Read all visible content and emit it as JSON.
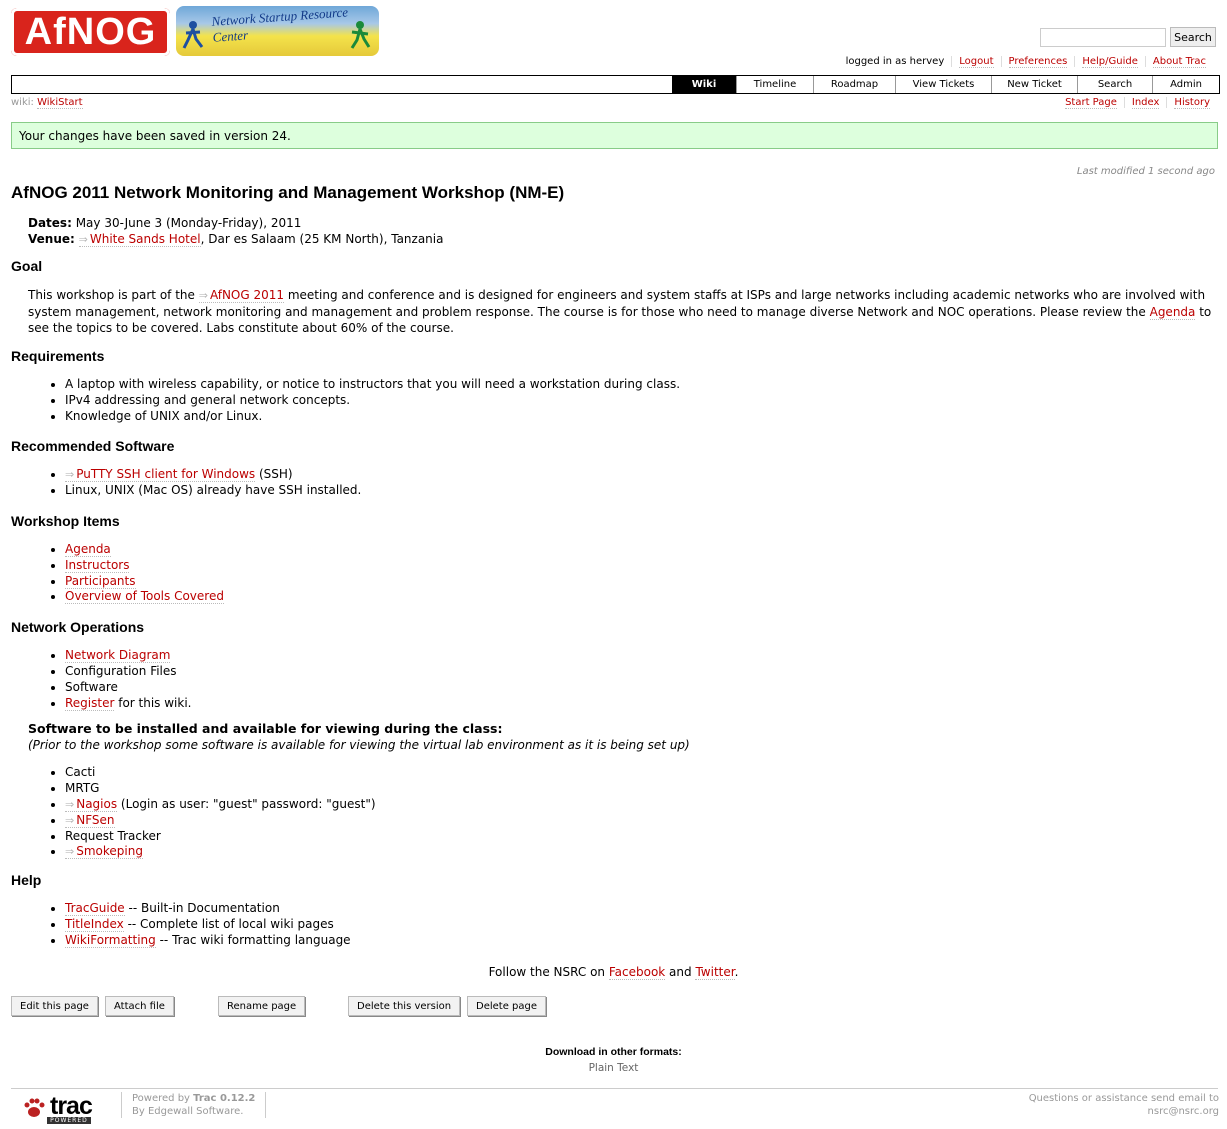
{
  "header": {
    "logo_text": "AfNOG",
    "nsrc_logo_text": "Network Startup Resource Center",
    "search_button": "Search",
    "search_placeholder": ""
  },
  "metanav": [
    "logged in as hervey",
    "Logout",
    "Preferences",
    "Help/Guide",
    "About Trac"
  ],
  "mainnav": [
    "Wiki",
    "Timeline",
    "Roadmap",
    "View Tickets",
    "New Ticket",
    "Search",
    "Admin"
  ],
  "breadcrumb": {
    "prefix": "wiki:",
    "page": "WikiStart"
  },
  "ctxnav": [
    "Start Page",
    "Index",
    "History"
  ],
  "notice": "Your changes have been saved in version 24.",
  "last_modified": "Last modified 1 second ago",
  "title": "AfNOG 2011 Network Monitoring and Management Workshop (NM-E)",
  "dates_label": "Dates:",
  "dates_value": "May 30-June 3 (Monday-Friday), 2011",
  "venue_label": "Venue:",
  "venue_link": "White Sands Hotel",
  "venue_rest": ", Dar es Salaam (25 KM North), Tanzania",
  "goal": {
    "heading": "Goal",
    "t1": "This workshop is part of the ",
    "link1": "AfNOG 2011",
    "t2": " meeting and conference and is designed for engineers and system staffs at ISPs and large networks including academic networks who are involved with system management, network monitoring and management and problem response. The course is for those who need to manage diverse Network and NOC operations. Please review the ",
    "link2": "Agenda",
    "t3": " to see the topics to be covered. Labs constitute about 60% of the course."
  },
  "requirements": {
    "heading": "Requirements",
    "items": [
      "A laptop with wireless capability, or notice to instructors that you will need a workstation during class.",
      "IPv4 addressing and general network concepts.",
      "Knowledge of UNIX and/or Linux."
    ]
  },
  "software": {
    "heading": "Recommended Software",
    "putty_link": "PuTTY SSH client for Windows",
    "putty_rest": " (SSH)",
    "linux": "Linux, UNIX (Mac OS) already have SSH installed."
  },
  "workshop_items": {
    "heading": "Workshop Items",
    "items": [
      "Agenda",
      "Instructors",
      "Participants",
      "Overview of Tools Covered"
    ]
  },
  "netops": {
    "heading": "Network Operations",
    "diagram": "Network Diagram",
    "config": "Configuration Files",
    "software": "Software",
    "register_link": "Register",
    "register_rest": " for this wiki."
  },
  "install": {
    "heading": "Software to be installed and available for viewing during the class:",
    "note": "(Prior to the workshop some software is available for viewing the virtual lab environment as it is being set up)",
    "cacti": "Cacti",
    "mrtg": "MRTG",
    "nagios_link": "Nagios",
    "nagios_rest": " (Login as user: \"guest\" password: \"guest\")",
    "nfsen_link": "NFSen",
    "rt": "Request Tracker",
    "smoke_link": "Smokeping"
  },
  "help": {
    "heading": "Help",
    "items": [
      {
        "link": "TracGuide",
        "rest": " -- Built-in Documentation"
      },
      {
        "link": "TitleIndex",
        "rest": " -- Complete list of local wiki pages"
      },
      {
        "link": "WikiFormatting",
        "rest": " -- Trac wiki formatting language"
      }
    ]
  },
  "follow": {
    "t1": "Follow the NSRC on ",
    "facebook": "Facebook",
    "and": " and ",
    "twitter": "Twitter",
    "end": "."
  },
  "buttons": [
    "Edit this page",
    "Attach file",
    "Rename page",
    "Delete this version",
    "Delete page"
  ],
  "download": {
    "title": "Download in other formats:",
    "item": "Plain Text"
  },
  "footer": {
    "trac_word": "trac",
    "trac_powered": "POWERED",
    "powered_by": "Powered by ",
    "trac_version": "Trac 0.12.2",
    "by_line": "By Edgewall Software.",
    "questions": "Questions or assistance send email to",
    "email": "nsrc@nsrc.org"
  },
  "colors": {
    "link": "#bb0000",
    "notice_bg": "#ddffdd",
    "nav_active": "#000000"
  }
}
